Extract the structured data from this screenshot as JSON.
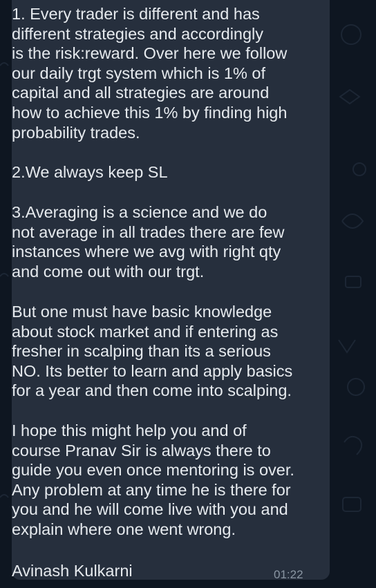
{
  "message": {
    "paragraphs": [
      "1. Every trader is different and has\ndifferent strategies and accordingly\nis the risk:reward. Over here we follow\nour daily trgt system which is 1% of\ncapital and all strategies are around\nhow to achieve this 1% by finding high\nprobability trades.",
      "2.We always keep SL",
      "3.Averaging is a science and we do\nnot average in all trades there are few\ninstances where we avg with right qty\nand come out with our trgt.",
      "But one must have basic knowledge\nabout stock market and if entering as\nfresher in scalping than its a serious\nNO. Its better to learn and apply basics\nfor a year and then come into scalping.",
      "I hope this might help you and of\ncourse Pranav Sir is always there to\nguide you even once mentoring is over.\nAny problem at any time he is there for\nyou and he will come live with you and\nexplain where one went wrong."
    ],
    "signature": "Avinash Kulkarni",
    "time": "01:22"
  },
  "colors": {
    "chat_background": "#0e1621",
    "bubble_background": "#262f3d",
    "message_text": "#e6eaee",
    "timestamp_text": "#8a96a3"
  }
}
